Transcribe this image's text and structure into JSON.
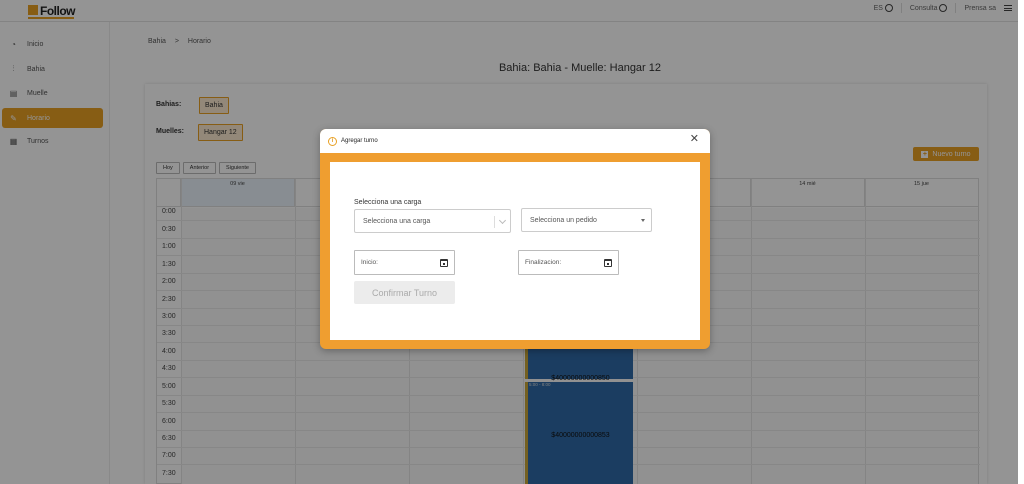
{
  "header": {
    "logo_text": "Follow",
    "lang": "ES",
    "consulta_label": "Consulta",
    "user_label": "Prensa sa"
  },
  "sidebar": {
    "items": [
      {
        "label": "Inicio",
        "icon": "speedometer-icon"
      },
      {
        "label": "Bahia",
        "icon": "bar-chart-icon"
      },
      {
        "label": "Muelle",
        "icon": "dock-icon"
      },
      {
        "label": "Horario",
        "icon": "edit-icon",
        "active": true
      },
      {
        "label": "Turnos",
        "icon": "calendar-table-icon"
      }
    ]
  },
  "breadcrumb": {
    "parent": "Bahia",
    "separator": ">",
    "current": "Horario"
  },
  "page_title": "Bahia: Bahia - Muelle: Hangar 12",
  "filters": {
    "bahias_label": "Bahias:",
    "bahia_value": "Bahia",
    "muelles_label": "Muelles:",
    "muelle_value": "Hangar 12"
  },
  "calendar_nav": {
    "today": "Hoy",
    "prev": "Anterior",
    "next": "Siguiente"
  },
  "new_button": "Nuevo turno",
  "calendar": {
    "days": [
      "09 vie",
      "",
      "",
      "",
      "",
      "14 mié",
      "15 jue"
    ],
    "hours": [
      "0:00",
      "0:30",
      "1:00",
      "1:30",
      "2:00",
      "2:30",
      "3:00",
      "3:30",
      "4:00",
      "4:30",
      "5:00",
      "5:30",
      "6:00",
      "6:30",
      "7:00",
      "7:30"
    ],
    "events": [
      {
        "code": "$40000000000850",
        "time": ""
      },
      {
        "code": "$40000000000853",
        "time": "5:00 - 8:00"
      }
    ]
  },
  "modal": {
    "title": "Agregar turno",
    "carga_label": "Selecciona una carga",
    "carga_placeholder": "Selecciona una carga",
    "pedido_placeholder": "Selecciona un pedido",
    "inicio_placeholder": "Inicio:",
    "fin_placeholder": "Finalizacion:",
    "confirm_label": "Confirmar Turno"
  },
  "colors": {
    "accent": "#e8a024",
    "event": "#2f6aa7"
  }
}
